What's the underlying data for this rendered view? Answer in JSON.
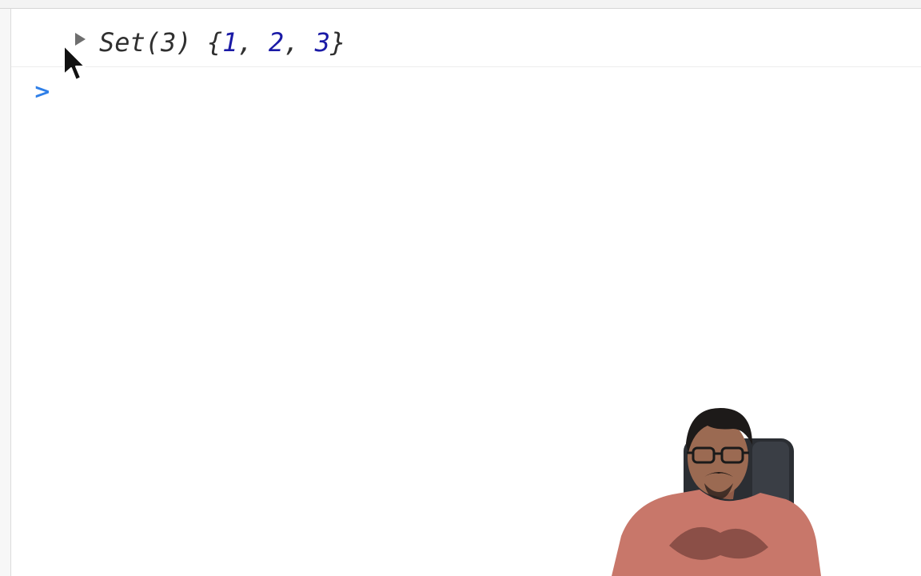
{
  "console": {
    "log": {
      "prefix": "Set(3) {",
      "items": [
        "1",
        "2",
        "3"
      ],
      "separator": ", ",
      "suffix": "}"
    },
    "prompt_symbol": ">"
  }
}
